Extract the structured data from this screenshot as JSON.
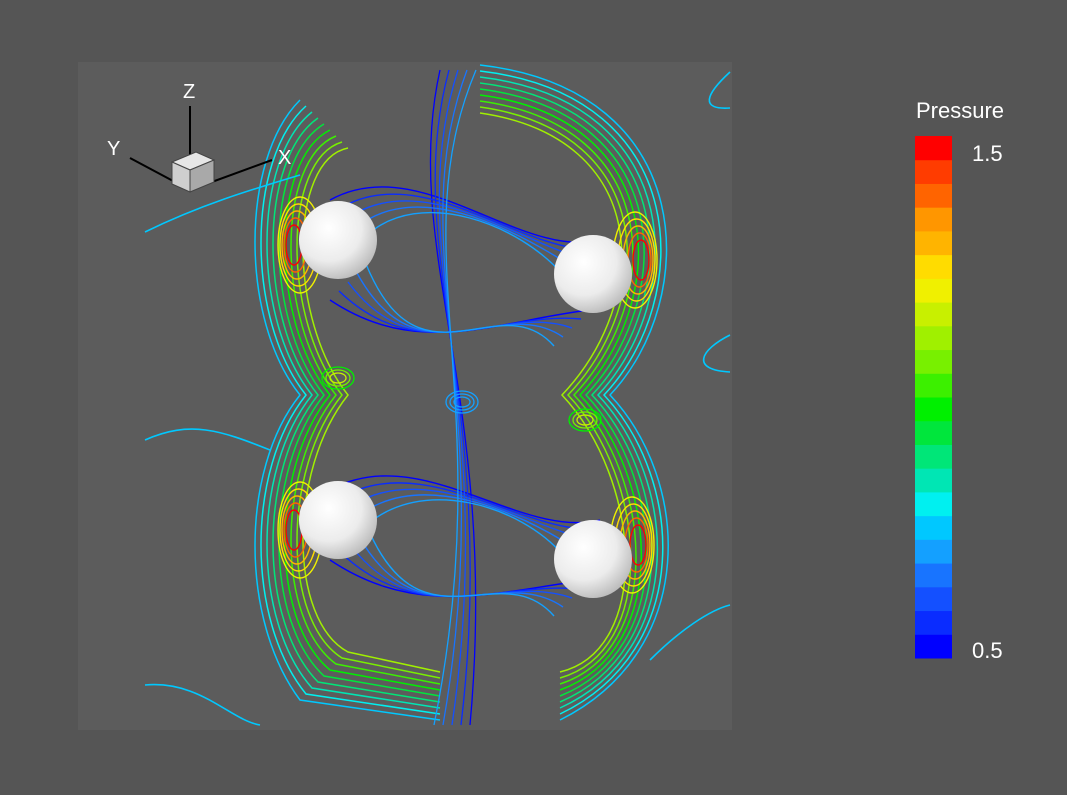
{
  "colorbar": {
    "title": "Pressure",
    "max_label": "1.5",
    "min_label": "0.5",
    "levels": [
      "#0000ff",
      "#0a2cff",
      "#1450ff",
      "#1874ff",
      "#14a0ff",
      "#00c8ff",
      "#00f0f0",
      "#00e6b4",
      "#00e678",
      "#00e63c",
      "#00f000",
      "#3cf000",
      "#78f000",
      "#a0f000",
      "#c8f000",
      "#f0f000",
      "#ffdc00",
      "#ffb400",
      "#ff9600",
      "#ff6400",
      "#ff3c00",
      "#ff0000"
    ]
  },
  "axes_triad": {
    "x_label": "X",
    "y_label": "Y",
    "z_label": "Z"
  },
  "colors": {
    "background": "#555555",
    "plot_background": "#5c5c5c",
    "sphere": "#f2f2f2"
  },
  "spheres": [
    {
      "name": "sphere-top-left"
    },
    {
      "name": "sphere-top-right"
    },
    {
      "name": "sphere-bottom-left"
    },
    {
      "name": "sphere-bottom-right"
    }
  ]
}
